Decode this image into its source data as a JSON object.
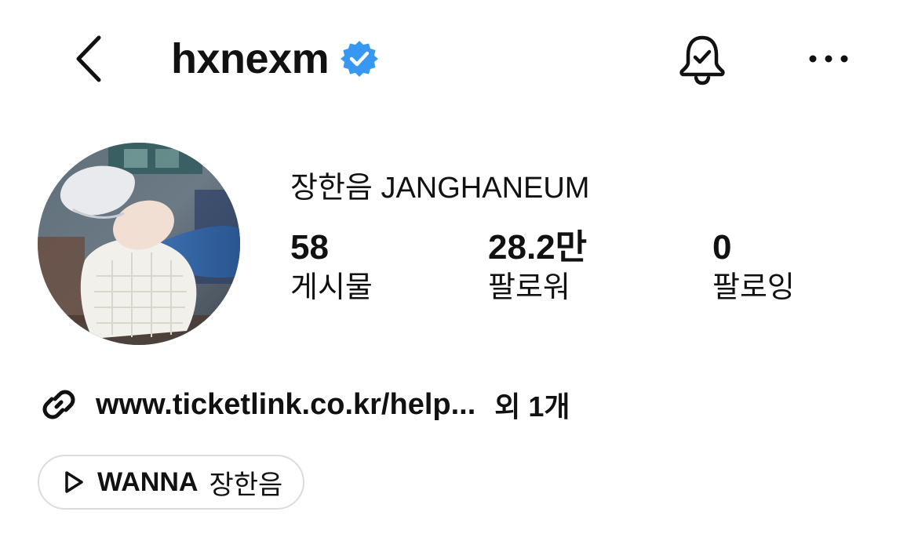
{
  "header": {
    "username": "hxnexm",
    "verified": true,
    "back_icon": "chevron-left-icon",
    "bell_icon": "bell-check-icon",
    "more_icon": "more-horizontal-icon"
  },
  "profile": {
    "display_name": "장한음 JANGHANEUM",
    "stats": [
      {
        "value": "58",
        "label": "게시물"
      },
      {
        "value": "28.2만",
        "label": "팔로워"
      },
      {
        "value": "0",
        "label": "팔로잉"
      }
    ]
  },
  "link": {
    "icon": "link-icon",
    "url": "www.ticketlink.co.kr/help...",
    "extra": "외 1개"
  },
  "music": {
    "icon": "play-icon",
    "title": "WANNA",
    "artist": "장한음"
  },
  "colors": {
    "verified_badge": "#3897f0",
    "text": "#111111",
    "pill_border": "#dcdcdc"
  }
}
